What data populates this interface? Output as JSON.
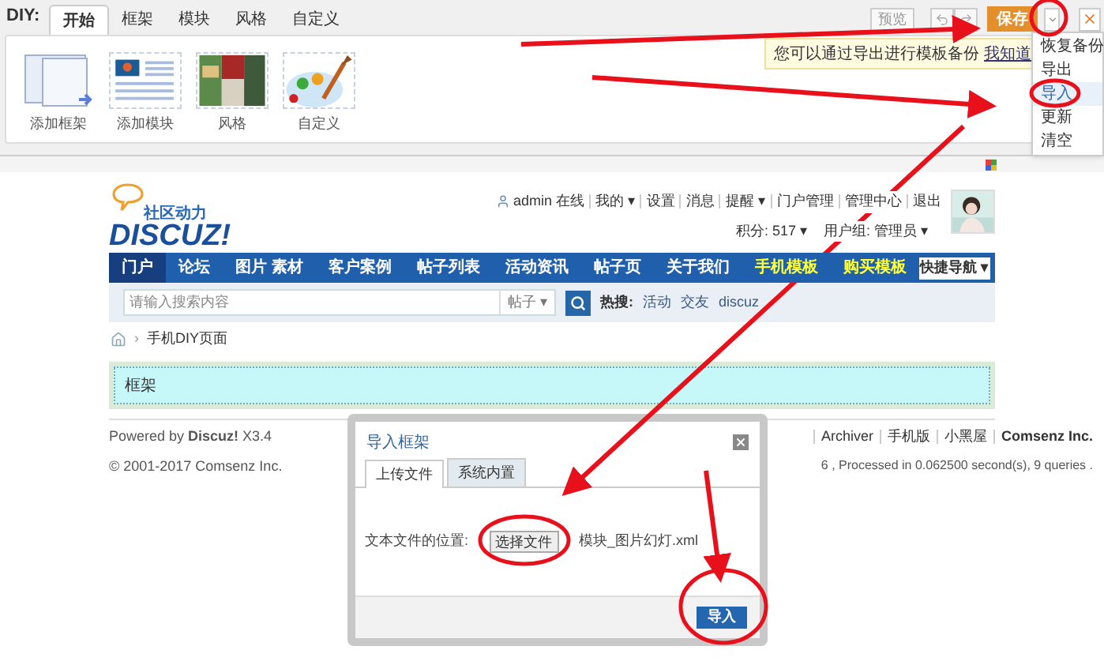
{
  "diy_bar": {
    "label": "DIY:",
    "tabs": [
      {
        "label": "开始",
        "selected": true
      },
      {
        "label": "框架",
        "selected": false
      },
      {
        "label": "模块",
        "selected": false
      },
      {
        "label": "风格",
        "selected": false
      },
      {
        "label": "自定义",
        "selected": false
      }
    ],
    "tools": [
      {
        "label": "添加框架",
        "kind": "frame"
      },
      {
        "label": "添加模块",
        "kind": "module"
      },
      {
        "label": "风格",
        "kind": "style"
      },
      {
        "label": "自定义",
        "kind": "custom"
      }
    ],
    "preview": "预览",
    "save": "保存"
  },
  "tooltip": {
    "text": "您可以通过导出进行模板备份",
    "link": "我知道"
  },
  "menu": {
    "items": [
      {
        "label": "恢复备份",
        "selected": false
      },
      {
        "label": "导出",
        "selected": false
      },
      {
        "label": "导入",
        "selected": true
      },
      {
        "label": "更新",
        "selected": false
      },
      {
        "label": "清空",
        "selected": false
      }
    ]
  },
  "header": {
    "slogan": "社区动力",
    "logo": "DISCUZ!",
    "user_links": [
      "admin 在线",
      "我的 ▾",
      "设置",
      "消息",
      "提醒 ▾",
      "门户管理",
      "管理中心",
      "退出"
    ],
    "user_stats": [
      "积分: 517 ▾",
      "用户组: 管理员 ▾"
    ]
  },
  "nav": {
    "items": [
      {
        "label": "门户",
        "selected": true,
        "highlighted": false
      },
      {
        "label": "论坛",
        "selected": false,
        "highlighted": false
      },
      {
        "label": "图片 素材",
        "selected": false,
        "highlighted": false
      },
      {
        "label": "客户案例",
        "selected": false,
        "highlighted": false
      },
      {
        "label": "帖子列表",
        "selected": false,
        "highlighted": false
      },
      {
        "label": "活动资讯",
        "selected": false,
        "highlighted": false
      },
      {
        "label": "帖子页",
        "selected": false,
        "highlighted": false
      },
      {
        "label": "关于我们",
        "selected": false,
        "highlighted": false
      },
      {
        "label": "手机模板",
        "selected": false,
        "highlighted": true
      },
      {
        "label": "购买模板",
        "selected": false,
        "highlighted": true
      }
    ],
    "quick_nav": "快捷导航 ▾"
  },
  "search": {
    "placeholder": "请输入搜索内容",
    "scope": "帖子 ▾",
    "hot_label": "热搜:",
    "hot": [
      "活动",
      "交友",
      "discuz"
    ]
  },
  "breadcrumb": {
    "separator": "›",
    "page": "手机DIY页面"
  },
  "frame": {
    "label": "框架"
  },
  "footer": {
    "powered": "Powered by **Discuz!** X3.4",
    "copyright": "© 2001-2017 Comsenz Inc.",
    "links": [
      "Archiver",
      "手机版",
      "小黑屋",
      "Comsenz Inc."
    ],
    "stats": "6 , Processed in 0.062500 second(s), 9 queries ."
  },
  "dialog": {
    "title": "导入框架",
    "tabs": [
      {
        "label": "上传文件",
        "selected": true
      },
      {
        "label": "系统内置",
        "selected": false
      }
    ],
    "field_label": "文本文件的位置:",
    "choose": "选择文件",
    "file": "模块_图片幻灯.xml",
    "submit": "导入"
  }
}
